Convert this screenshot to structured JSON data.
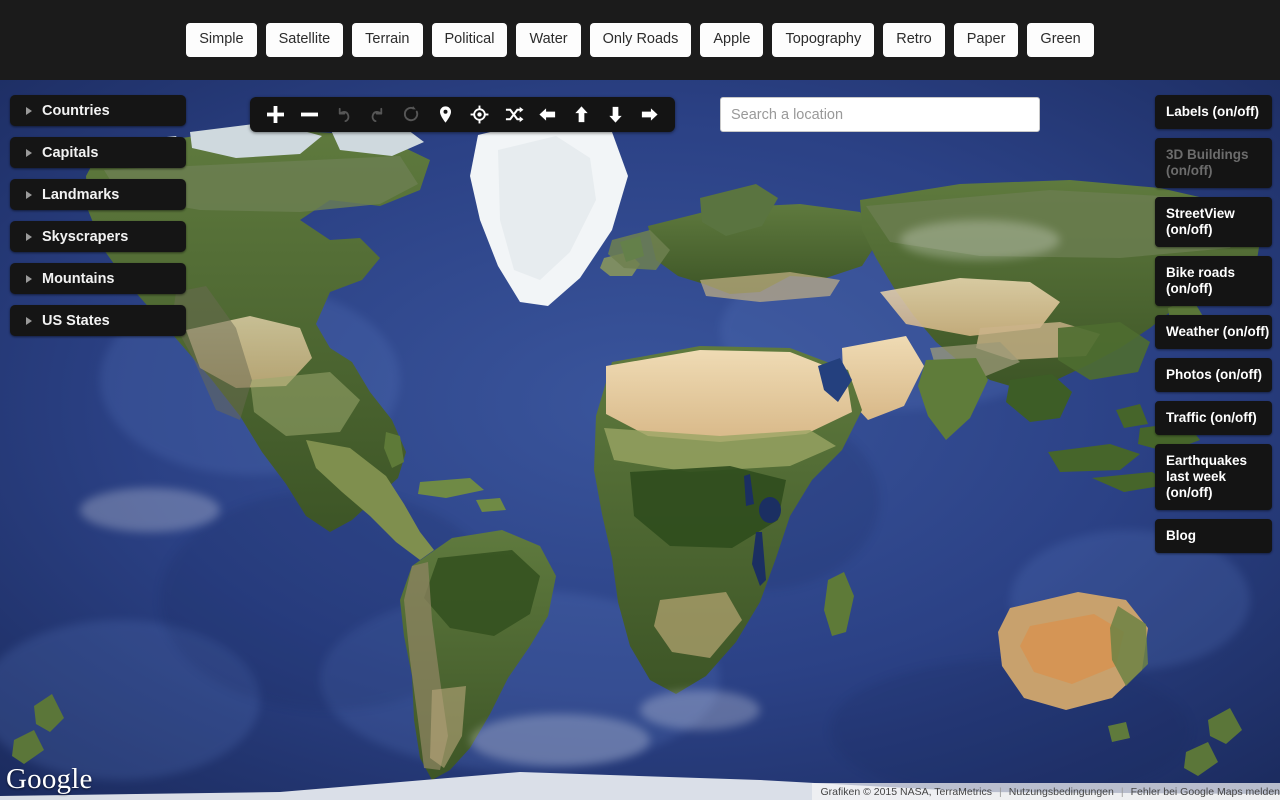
{
  "topbar": {
    "styles": [
      {
        "label": "Simple"
      },
      {
        "label": "Satellite"
      },
      {
        "label": "Terrain"
      },
      {
        "label": "Political"
      },
      {
        "label": "Water"
      },
      {
        "label": "Only Roads"
      },
      {
        "label": "Apple"
      },
      {
        "label": "Topography"
      },
      {
        "label": "Retro"
      },
      {
        "label": "Paper"
      },
      {
        "label": "Green"
      }
    ]
  },
  "left_panel": {
    "items": [
      {
        "label": "Countries"
      },
      {
        "label": "Capitals"
      },
      {
        "label": "Landmarks"
      },
      {
        "label": "Skyscrapers"
      },
      {
        "label": "Mountains"
      },
      {
        "label": "US States"
      }
    ]
  },
  "toolbar": {
    "buttons": [
      {
        "icon": "plus-icon",
        "name": "zoom-in-button",
        "enabled": true
      },
      {
        "icon": "minus-icon",
        "name": "zoom-out-button",
        "enabled": true
      },
      {
        "icon": "undo-icon",
        "name": "undo-button",
        "enabled": false
      },
      {
        "icon": "redo-icon",
        "name": "redo-button",
        "enabled": false
      },
      {
        "icon": "rotate-icon",
        "name": "reset-button",
        "enabled": false
      },
      {
        "icon": "map-marker-icon",
        "name": "add-marker-button",
        "enabled": true
      },
      {
        "icon": "crosshair-icon",
        "name": "locate-me-button",
        "enabled": true
      },
      {
        "icon": "shuffle-icon",
        "name": "random-place-button",
        "enabled": true
      },
      {
        "icon": "arrow-left-icon",
        "name": "pan-left-button",
        "enabled": true
      },
      {
        "icon": "arrow-up-icon",
        "name": "pan-up-button",
        "enabled": true
      },
      {
        "icon": "arrow-down-icon",
        "name": "pan-down-button",
        "enabled": true
      },
      {
        "icon": "arrow-right-icon",
        "name": "pan-right-button",
        "enabled": true
      }
    ]
  },
  "search": {
    "placeholder": "Search a location",
    "value": ""
  },
  "right_panel": {
    "items": [
      {
        "label": "Labels (on/off)",
        "enabled": true
      },
      {
        "label": "3D Buildings (on/off)",
        "enabled": false
      },
      {
        "label": "StreetView (on/off)",
        "enabled": true
      },
      {
        "label": "Bike roads (on/off)",
        "enabled": true
      },
      {
        "label": "Weather (on/off)",
        "enabled": true
      },
      {
        "label": "Photos (on/off)",
        "enabled": true
      },
      {
        "label": "Traffic (on/off)",
        "enabled": true
      },
      {
        "label": "Earthquakes last week (on/off)",
        "enabled": true
      },
      {
        "label": "Blog",
        "enabled": true
      }
    ]
  },
  "map": {
    "logo": "Google",
    "attribution": {
      "imagery": "Grafiken © 2015 NASA, TerraMetrics",
      "terms": "Nutzungsbedingungen",
      "report": "Fehler bei Google Maps melden"
    },
    "colors": {
      "ocean_deep": "#1f3168",
      "ocean_mid": "#2a4184",
      "ocean_shallow": "#3c5aa6",
      "land_green": "#4e6b34",
      "land_dark_green": "#3b5526",
      "desert": "#e8d0a8",
      "arid": "#c7a878",
      "ice": "#f4f6f8",
      "topbar_bg": "#1b1b1b",
      "panel_bg": "#141414"
    }
  }
}
